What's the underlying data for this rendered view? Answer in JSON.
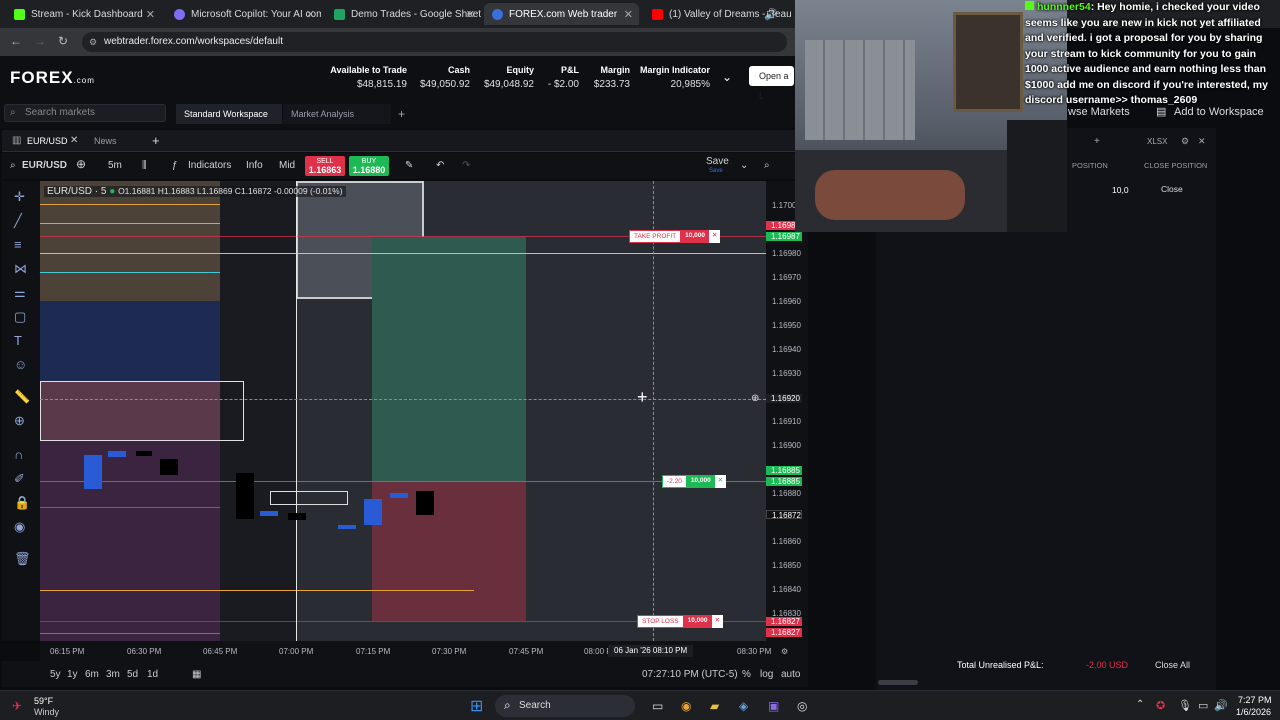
{
  "browser": {
    "tabs": [
      {
        "title": "Stream - Kick Dashboard",
        "color": "#53fc18",
        "active": false
      },
      {
        "title": "Microsoft Copilot: Your AI com",
        "color": "#7d6ef5",
        "active": false
      },
      {
        "title": "Demo Trades - Google Sheets",
        "color": "#1fa463",
        "active": false
      },
      {
        "title": "FOREX.com Web trader",
        "color": "#3a6fd8",
        "active": true
      },
      {
        "title": "(1) Valley of Dreams - Beau",
        "color": "#ff0000",
        "active": false
      }
    ],
    "url": "webtrader.forex.com/workspaces/default"
  },
  "header": {
    "logo": "FOREX",
    "logo_suffix": ".com",
    "stats": [
      {
        "label": "Available to Trade",
        "value": "$48,815.19"
      },
      {
        "label": "Cash",
        "value": "$49,050.92"
      },
      {
        "label": "Equity",
        "value": "$49,048.92"
      },
      {
        "label": "P&L",
        "value": "- $2.00"
      },
      {
        "label": "Margin",
        "value": "$233.73"
      },
      {
        "label": "Margin Indicator",
        "value": "20,985%"
      }
    ],
    "open_button": "Open a L"
  },
  "search": {
    "placeholder": "Search markets"
  },
  "workspaces": [
    "Standard Workspace",
    "Market Analysis"
  ],
  "panel_tabs": [
    "EUR/USD",
    "News"
  ],
  "toolbar": {
    "symbol": "EUR/USD",
    "interval": "5m",
    "indicators": "Indicators",
    "info": "Info",
    "mid": "Mid",
    "sell_label": "SELL",
    "sell_price": "1.16863",
    "buy_label": "BUY",
    "buy_price": "1.16880",
    "save": "Save",
    "save_sub": "Save"
  },
  "chart": {
    "legend_symbol": "EUR/USD · 5",
    "legend_ohlc": "O1.16881 H1.16883 L1.16869 C1.16872 -0.00009 (-0.01%)",
    "take_profit": {
      "label": "TAKE PROFIT",
      "qty": "10,000"
    },
    "position": {
      "pnl": "-2.20",
      "qty": "10,000"
    },
    "stop_loss": {
      "label": "STOP LOSS",
      "qty": "10,000"
    },
    "price_ticks": [
      "1.17000",
      "1.16980",
      "1.16970",
      "1.16960",
      "1.16950",
      "1.16940",
      "1.16930",
      "1.16920",
      "1.16910",
      "1.16900",
      "1.16880",
      "1.16860",
      "1.16850",
      "1.16840",
      "1.16830"
    ],
    "badges": [
      {
        "text": "1.16987",
        "color": "#e0314b"
      },
      {
        "text": "1.16987",
        "color": "#1db954"
      },
      {
        "text": "1.16885",
        "color": "#1db954"
      },
      {
        "text": "1.16885",
        "color": "#1db954"
      },
      {
        "text": "1.16872",
        "color": "#111"
      },
      {
        "text": "1.16827",
        "color": "#e0314b"
      },
      {
        "text": "1.16827",
        "color": "#e0314b"
      }
    ],
    "crosshair_price": "1.16920",
    "time_ticks": [
      "06:15 PM",
      "06:30 PM",
      "06:45 PM",
      "07:00 PM",
      "07:15 PM",
      "07:30 PM",
      "07:45 PM",
      "08:00 PM",
      "08:30 PM"
    ],
    "crosshair_time": "06 Jan '26   08:10 PM"
  },
  "bottom": {
    "ranges": [
      "5y",
      "1y",
      "6m",
      "3m",
      "5d",
      "1d"
    ],
    "clock": "07:27:10 PM (UTC-5)",
    "opts": [
      "%",
      "log",
      "auto"
    ]
  },
  "chat": {
    "user": "hunnner54",
    "message": ": Hey homie, i checked your video seems like you are new in kick not yet affiliated and verified. i got a proposal for you by sharing your stream to kick community for you to gain 1000 active audience and earn nothing less than $1000 add me on discord if you're interested, my discord username>> thomas_2609"
  },
  "right_panel": {
    "browse": "wse Markets",
    "add_workspace": "Add to Workspace",
    "export": "XLSX",
    "col_position": "POSITION",
    "col_close": "CLOSE POSITION",
    "row_position": "10,0",
    "row_close": "Close",
    "total_label": "Total Unrealised P&L:",
    "total_value": "-2.00 USD",
    "close_all": "Close All"
  },
  "taskbar": {
    "weather_temp": "59°F",
    "weather_desc": "Windy",
    "search": "Search",
    "time": "7:27 PM",
    "date": "1/6/2026"
  }
}
